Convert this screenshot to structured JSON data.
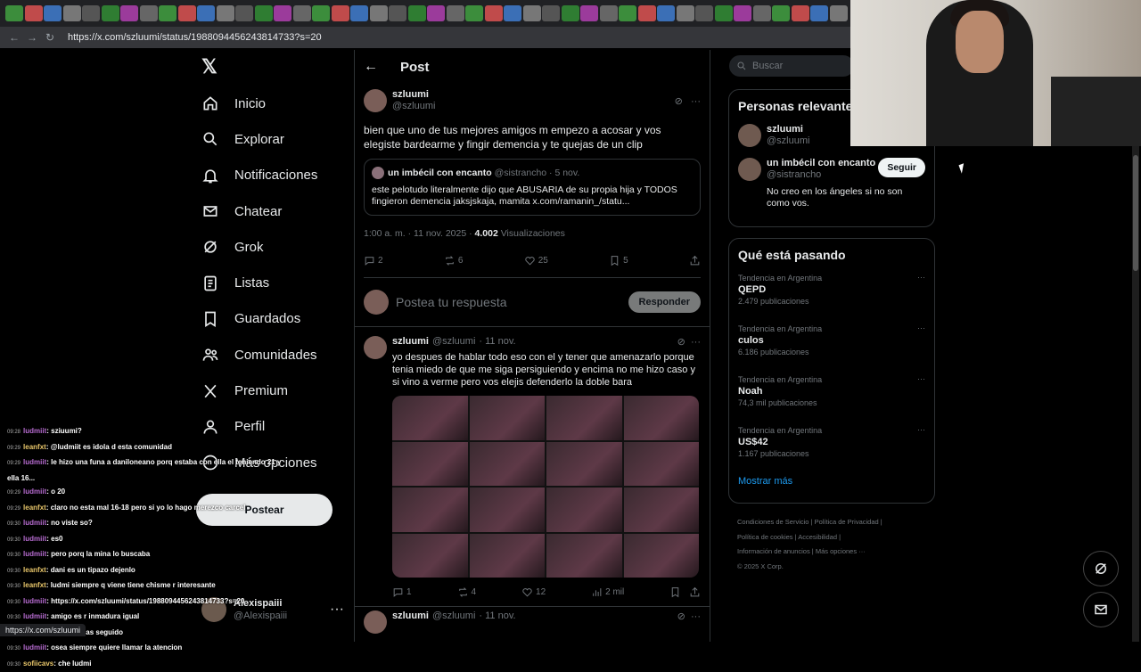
{
  "browser": {
    "url": "https://x.com/szluumi/status/1988094456243814733?s=20",
    "status_url": "https://x.com/szluumi"
  },
  "nav": {
    "items": [
      {
        "label": "Inicio",
        "icon": "home-icon"
      },
      {
        "label": "Explorar",
        "icon": "search-icon"
      },
      {
        "label": "Notificaciones",
        "icon": "bell-icon"
      },
      {
        "label": "Chatear",
        "icon": "mail-icon"
      },
      {
        "label": "Grok",
        "icon": "grok-icon"
      },
      {
        "label": "Listas",
        "icon": "list-icon"
      },
      {
        "label": "Guardados",
        "icon": "bookmark-icon"
      },
      {
        "label": "Comunidades",
        "icon": "people-icon"
      },
      {
        "label": "Premium",
        "icon": "x-icon"
      },
      {
        "label": "Perfil",
        "icon": "person-icon"
      },
      {
        "label": "Más opciones",
        "icon": "more-icon"
      }
    ],
    "post_label": "Postear",
    "account": {
      "name": "Alexispaiii",
      "handle": "@Alexispaiii"
    }
  },
  "header": {
    "title": "Post"
  },
  "tweet": {
    "name": "szluumi",
    "handle": "@szluumi",
    "text": "bien que uno de tus mejores amigos m empezo a acosar y vos elegiste bardearme y fingir demencia y te quejas de un clip",
    "quote": {
      "name": "un imbécil con encanto",
      "handle": "@sistrancho",
      "date": "· 5 nov.",
      "text": "este pelotudo literalmente dijo que ABUSARIA de su propia hija y TODOS fingieron demencia jaksjskaja, mamita x.com/ramanin_/statu..."
    },
    "timestamp": "1:00 a. m. · 11 nov. 2025 · ",
    "views": "4.002",
    "views_label": " Visualizaciones",
    "replies": "2",
    "retweets": "6",
    "likes": "25",
    "bookmarks": "5"
  },
  "reply": {
    "placeholder": "Postea tu respuesta",
    "button": "Responder"
  },
  "reply_tweet": {
    "name": "szluumi",
    "handle": "@szluumi",
    "date": "· 11 nov.",
    "text": "yo despues de hablar todo eso con el y tener que amenazarlo porque tenia miedo de que me siga persiguiendo y encima no me hizo caso y si vino a verme pero vos elejis defenderlo la doble bara",
    "replies": "1",
    "retweets": "4",
    "likes": "12",
    "views": "2 mil"
  },
  "next_tweet": {
    "name": "szluumi",
    "handle": "@szluumi",
    "date": "· 11 nov."
  },
  "search": {
    "placeholder": "Buscar"
  },
  "relevant": {
    "title": "Personas relevantes",
    "people": [
      {
        "name": "szluumi",
        "handle": "@szluumi"
      },
      {
        "name": "un imbécil con encanto",
        "handle": "@sistrancho",
        "follow": "Seguir",
        "bio": "No creo en los ángeles si no son como vos."
      }
    ]
  },
  "trending": {
    "title": "Qué está pasando",
    "items": [
      {
        "context": "Tendencia en Argentina",
        "name": "QEPD",
        "count": "2.479 publicaciones"
      },
      {
        "context": "Tendencia en Argentina",
        "name": "culos",
        "count": "6.186 publicaciones"
      },
      {
        "context": "Tendencia en Argentina",
        "name": "Noah",
        "count": "74,3 mil publicaciones"
      },
      {
        "context": "Tendencia en Argentina",
        "name": "US$42",
        "count": "1.167 publicaciones"
      }
    ],
    "more": "Mostrar más"
  },
  "footer": {
    "line1": "Condiciones de Servicio  |  Política de Privacidad  |",
    "line2": "Política de cookies  |  Accesibilidad  |",
    "line3": "Información de anuncios  |  Más opciones ···",
    "line4": "© 2025 X Corp."
  },
  "chat": [
    {
      "time": "09:28",
      "user": "ludmiit",
      "msg": ": sziuumi?"
    },
    {
      "time": "09:29",
      "user": "leanfxt",
      "msg": ": @ludmiit es idola d esta comunidad"
    },
    {
      "time": "09:29",
      "user": "ludmiit",
      "msg": ": le hizo una funa a daniloneano porq estaba con ella el teniendo 21 y ella 16..."
    },
    {
      "time": "09:29",
      "user": "ludmiit",
      "msg": ": o 20"
    },
    {
      "time": "09:29",
      "user": "leanfxt",
      "msg": ": claro no esta mal 16-18 pero si yo lo hago merezco carcel"
    },
    {
      "time": "09:30",
      "user": "ludmiit",
      "msg": ": no viste so?"
    },
    {
      "time": "09:30",
      "user": "ludmiit",
      "msg": ": es0"
    },
    {
      "time": "09:30",
      "user": "ludmiit",
      "msg": ": pero porq la mina lo buscaba"
    },
    {
      "time": "09:30",
      "user": "leanfxt",
      "msg": ": dani es un tipazo dejenlo"
    },
    {
      "time": "09:30",
      "user": "leanfxt",
      "msg": ": ludmi siempre q viene tiene chisme r interesante"
    },
    {
      "time": "09:30",
      "user": "ludmiit",
      "msg": ": https://x.com/szluumi/status/1988094456243814733?s=20"
    },
    {
      "time": "09:30",
      "user": "ludmiit",
      "msg": ": amigo es r inmadura igual"
    },
    {
      "time": "09:30",
      "user": "leanfxt",
      "msg": ": q venga mas seguido"
    },
    {
      "time": "09:30",
      "user": "ludmiit",
      "msg": ": osea siempre quiere llamar la atencion"
    },
    {
      "time": "09:30",
      "user": "sofiicavs",
      "msg": ": che ludmi"
    }
  ]
}
